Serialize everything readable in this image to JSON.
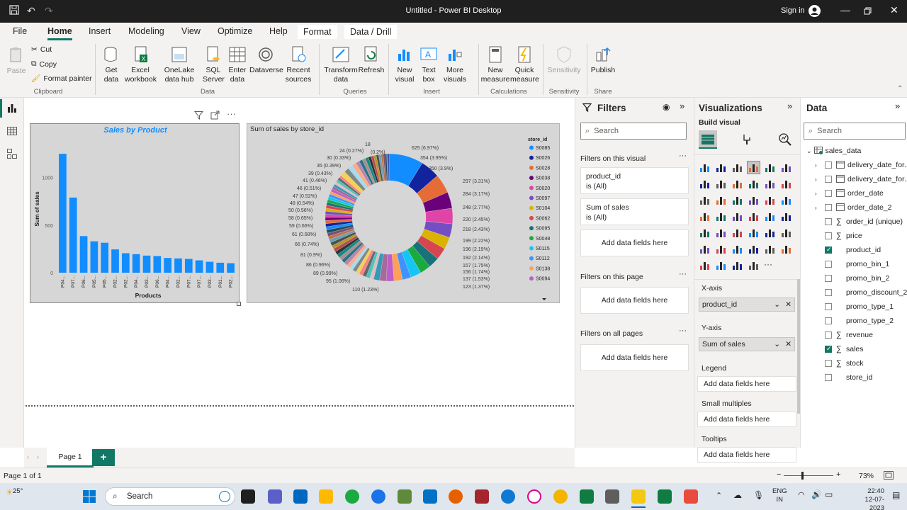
{
  "window": {
    "title": "Untitled - Power BI Desktop",
    "sign_in": "Sign in"
  },
  "menu": [
    {
      "label": "File"
    },
    {
      "label": "Home"
    },
    {
      "label": "Insert"
    },
    {
      "label": "Modeling"
    },
    {
      "label": "View"
    },
    {
      "label": "Optimize"
    },
    {
      "label": "Help"
    },
    {
      "label": "Format"
    },
    {
      "label": "Data / Drill"
    }
  ],
  "ribbon": {
    "paste": "Paste",
    "cut": "Cut",
    "copy": "Copy",
    "format_painter": "Format painter",
    "get_data": "Get data",
    "excel": "Excel workbook",
    "onelake": "OneLake data hub",
    "sql": "SQL Server",
    "enter_data": "Enter data",
    "dataverse": "Dataverse",
    "recent": "Recent sources",
    "transform": "Transform data",
    "refresh": "Refresh",
    "new_visual": "New visual",
    "text_box": "Text box",
    "more_visuals": "More visuals",
    "new_measure": "New measure",
    "quick_measure": "Quick measure",
    "sensitivity": "Sensitivity",
    "publish": "Publish",
    "groups": {
      "clipboard": "Clipboard",
      "data": "Data",
      "queries": "Queries",
      "insert": "Insert",
      "calculations": "Calculations",
      "sensitivity": "Sensitivity",
      "share": "Share"
    }
  },
  "bar_chart": {
    "title": "Sales by Product",
    "ylabel": "Sum of sales",
    "xlabel": "Products",
    "y_ticks": [
      "0",
      "500",
      "1000"
    ],
    "categories": [
      "P04...",
      "P07...",
      "P06...",
      "P05...",
      "P05...",
      "P02...",
      "P02...",
      "P04...",
      "P03...",
      "P06...",
      "P04...",
      "P02...",
      "P07...",
      "P07...",
      "P03...",
      "P01...",
      "P02..."
    ],
    "values": [
      1250,
      790,
      385,
      330,
      315,
      245,
      205,
      195,
      180,
      175,
      155,
      150,
      145,
      130,
      115,
      105,
      100
    ],
    "ylim": [
      0,
      1400
    ],
    "color": "#118dff"
  },
  "donut_chart": {
    "title": "Sum of sales by store_id",
    "legend_title": "store_id",
    "legend": [
      {
        "name": "S0085",
        "color": "#118dff"
      },
      {
        "name": "S0026",
        "color": "#12239e"
      },
      {
        "name": "S0028",
        "color": "#e66c37"
      },
      {
        "name": "S0038",
        "color": "#6b007b"
      },
      {
        "name": "S0020",
        "color": "#e044a7"
      },
      {
        "name": "S0097",
        "color": "#744ec2"
      },
      {
        "name": "S0104",
        "color": "#d9b300"
      },
      {
        "name": "S0062",
        "color": "#d64550"
      },
      {
        "name": "S0095",
        "color": "#197278"
      },
      {
        "name": "S0048",
        "color": "#1aab40"
      },
      {
        "name": "S0115",
        "color": "#15c6f4"
      },
      {
        "name": "S0112",
        "color": "#4092ff"
      },
      {
        "name": "S0138",
        "color": "#ffa058"
      },
      {
        "name": "S0094",
        "color": "#be5dc9"
      }
    ],
    "labels_right": [
      "625 (6.97%)",
      "354 (3.95%)",
      "350 (3.9%)",
      "297 (3.31%)",
      "284 (3.17%)",
      "248 (2.77%)",
      "220 (2.45%)",
      "218 (2.43%)",
      "199 (2.22%)",
      "196 (2.19%)",
      "192 (2.14%)",
      "157 (1.75%)",
      "156 (1.74%)",
      "137 (1.53%)",
      "123 (1.37%)",
      "110 (1.23%)"
    ],
    "labels_left": [
      "18",
      "24 (0.27%)",
      "30 (0.33%)",
      "35 (0.39%)",
      "39 (0.43%)",
      "41 (0.46%)",
      "46 (0.51%)",
      "47 (0.52%)",
      "48 (0.54%)",
      "50 (0.56%)",
      "58 (0.65%)",
      "59 (0.66%)",
      "61 (0.68%)",
      "66 (0.74%)",
      "81 (0.9%)",
      "86 (0.96%)",
      "89 (0.99%)",
      "95 (1.06%)"
    ],
    "label_top_extra": "(0.2%)"
  },
  "filters": {
    "title": "Filters",
    "search": "Search",
    "on_visual": "Filters on this visual",
    "card1_field": "product_id",
    "card1_state": "is (All)",
    "card2_field": "Sum of sales",
    "card2_state": "is (All)",
    "add_fields": "Add data fields here",
    "on_page": "Filters on this page",
    "on_all": "Filters on all pages"
  },
  "visualizations": {
    "title": "Visualizations",
    "build_visual": "Build visual",
    "xaxis_label": "X-axis",
    "xaxis_field": "product_id",
    "yaxis_label": "Y-axis",
    "yaxis_field": "Sum of sales",
    "legend_label": "Legend",
    "small_multiples_label": "Small multiples",
    "tooltips_label": "Tooltips",
    "add_fields": "Add data fields here"
  },
  "data_pane": {
    "title": "Data",
    "search": "Search",
    "table": "sales_data",
    "fields": [
      {
        "name": "delivery_date_for...",
        "type": "date",
        "checked": false
      },
      {
        "name": "delivery_date_for...",
        "type": "date",
        "checked": false
      },
      {
        "name": "order_date",
        "type": "date",
        "checked": false
      },
      {
        "name": "order_date_2",
        "type": "date",
        "checked": false
      },
      {
        "name": "order_id (unique)",
        "type": "sigma",
        "checked": false
      },
      {
        "name": "price",
        "type": "sigma",
        "checked": false
      },
      {
        "name": "product_id",
        "type": "text",
        "checked": true
      },
      {
        "name": "promo_bin_1",
        "type": "text",
        "checked": false
      },
      {
        "name": "promo_bin_2",
        "type": "text",
        "checked": false
      },
      {
        "name": "promo_discount_2",
        "type": "text",
        "checked": false
      },
      {
        "name": "promo_type_1",
        "type": "text",
        "checked": false
      },
      {
        "name": "promo_type_2",
        "type": "text",
        "checked": false
      },
      {
        "name": "revenue",
        "type": "sigma",
        "checked": false
      },
      {
        "name": "sales",
        "type": "sigma",
        "checked": true
      },
      {
        "name": "stock",
        "type": "sigma",
        "checked": false
      },
      {
        "name": "store_id",
        "type": "text",
        "checked": false
      }
    ]
  },
  "pages": {
    "tab1": "Page 1",
    "add": "+"
  },
  "status": {
    "page_info": "Page 1 of 1",
    "zoom": "73%"
  },
  "taskbar": {
    "temp": "25°",
    "search": "Search",
    "lang1": "ENG",
    "lang2": "IN",
    "time": "22:40",
    "date": "12-07-2023"
  }
}
